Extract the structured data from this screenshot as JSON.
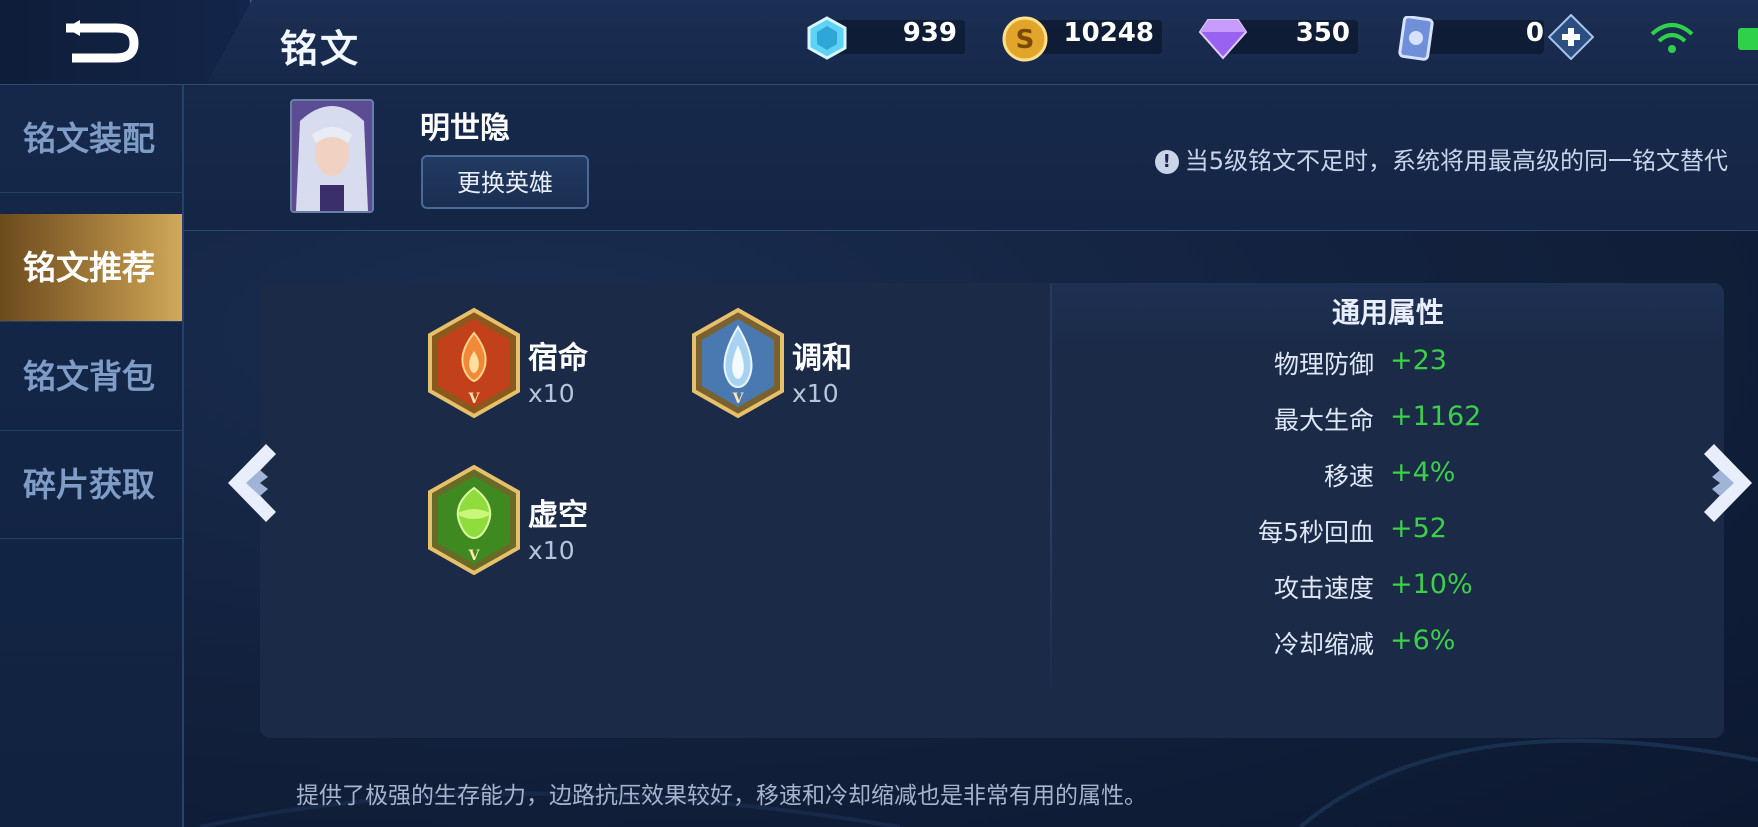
{
  "header": {
    "title": "铭文",
    "resources": [
      {
        "name": "gem",
        "icon": "blue-gem-icon",
        "value": "939"
      },
      {
        "name": "gold",
        "icon": "gold-coin-icon",
        "value": "10248"
      },
      {
        "name": "diamond",
        "icon": "purple-diamond-icon",
        "value": "350"
      },
      {
        "name": "coupon",
        "icon": "coupon-card-icon",
        "value": "0"
      }
    ]
  },
  "sidebar": {
    "items": [
      {
        "label": "铭文装配"
      },
      {
        "label": "铭文推荐"
      },
      {
        "label": "铭文背包"
      },
      {
        "label": "碎片获取"
      }
    ]
  },
  "hero": {
    "name": "明世隐",
    "change_button": "更换英雄",
    "notice": "当5级铭文不足时，系统将用最高级的同一铭文替代"
  },
  "runes": [
    {
      "name": "宿命",
      "count": "x10",
      "color": "#d0431c",
      "icon": "red-flame-rune-icon"
    },
    {
      "name": "调和",
      "count": "x10",
      "color": "#6fa3d6",
      "icon": "blue-drop-rune-icon"
    },
    {
      "name": "虚空",
      "count": "x10",
      "color": "#5fbf2a",
      "icon": "green-leaf-rune-icon"
    }
  ],
  "stats": {
    "title": "通用属性",
    "rows": [
      {
        "name": "物理防御",
        "value": "+23"
      },
      {
        "name": "最大生命",
        "value": "+1162"
      },
      {
        "name": "移速",
        "value": "+4%"
      },
      {
        "name": "每5秒回血",
        "value": "+52"
      },
      {
        "name": "攻击速度",
        "value": "+10%"
      },
      {
        "name": "冷却缩减",
        "value": "+6%"
      }
    ]
  },
  "description": "提供了极强的生存能力，边路抗压效果较好，移速和冷却缩减也是非常有用的属性。",
  "colors": {
    "accent_gold": "#b28a43",
    "stat_green": "#3ccf4a",
    "panel_bg": "#1a2a47"
  }
}
